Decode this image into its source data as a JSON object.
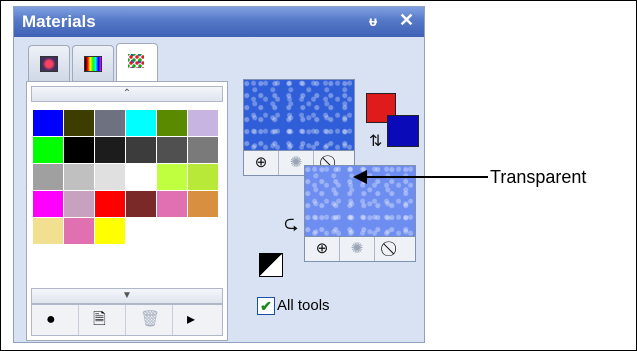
{
  "panel": {
    "title": "Materials",
    "pin_glyph": "ᵾ",
    "close_glyph": "✕"
  },
  "tabs": [
    {
      "name": "frame-tab",
      "icon": "frame-icon",
      "active": false
    },
    {
      "name": "spectrum-tab",
      "icon": "spectrum-icon",
      "active": false
    },
    {
      "name": "swatches-tab",
      "icon": "swatches-icon",
      "active": true
    }
  ],
  "swatches": {
    "colors": [
      "#0000ff",
      "#3d3d00",
      "#6e7280",
      "#00ffff",
      "#5a8a00",
      "#c8b4e0",
      "#00ff00",
      "#000000",
      "#1c1c1c",
      "#3c3c3c",
      "#505050",
      "#7a7a7a",
      "#a0a0a0",
      "#c0c0c0",
      "#e0e0e0",
      "#ffffff",
      "#c0ff40",
      "#b8e838",
      "#ff00ff",
      "#c8a0c0",
      "#ff0000",
      "#7a2828",
      "#e070b0",
      "#d89040",
      "#f0e090",
      "#e070b0",
      "#ffff00"
    ],
    "scroll_up_glyph": "⌃",
    "scroll_down_glyph": "▼"
  },
  "bottom_buttons": [
    {
      "name": "circle-button",
      "icon": "●"
    },
    {
      "name": "copy-button",
      "icon": "🗎"
    },
    {
      "name": "delete-button",
      "icon": "🗑"
    },
    {
      "name": "more-button",
      "icon": "▸"
    }
  ],
  "foreground_style": {
    "buttons": [
      {
        "name": "fg-style-button",
        "icon": "⊕"
      },
      {
        "name": "fg-texture-button",
        "icon": "✺"
      },
      {
        "name": "fg-transparent-button",
        "icon": "⃠"
      }
    ]
  },
  "background_style": {
    "buttons": [
      {
        "name": "bg-style-button",
        "icon": "⊕"
      },
      {
        "name": "bg-texture-button",
        "icon": "✺"
      },
      {
        "name": "bg-transparent-button",
        "icon": "⃠"
      }
    ]
  },
  "colors": {
    "foreground": "#e01b1b",
    "background": "#0a0ab8"
  },
  "all_tools": {
    "label": "All tools",
    "checked": true,
    "check_glyph": "✔"
  },
  "callout": {
    "text": "Transparent"
  }
}
